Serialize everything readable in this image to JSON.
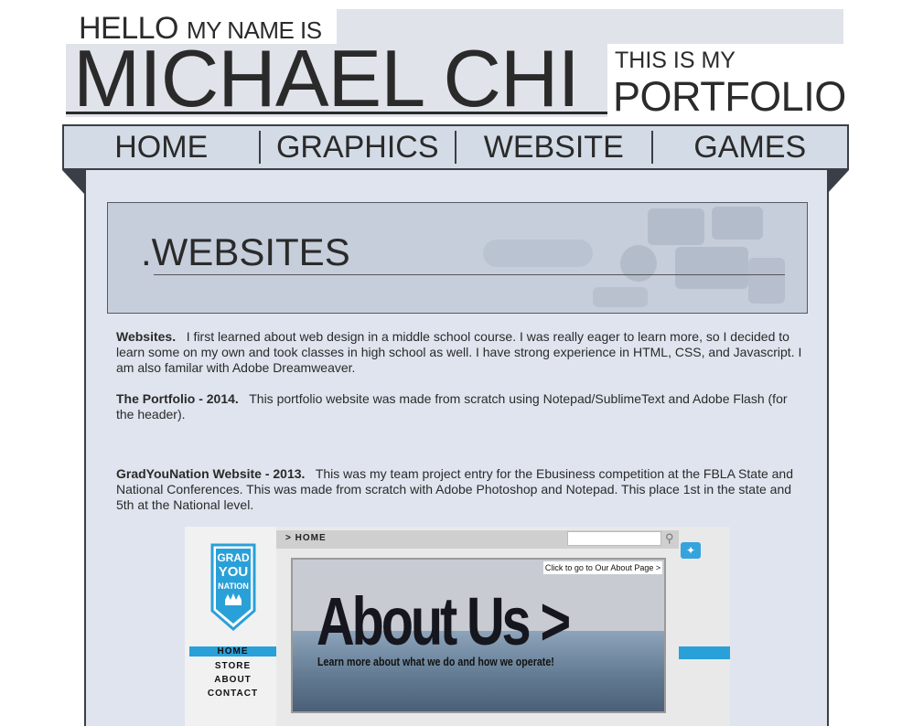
{
  "header": {
    "hello": "HELLO",
    "my_name_is": "MY NAME IS",
    "name": "MICHAEL CHI",
    "this_is_my": "THIS IS MY",
    "portfolio": "PORTFOLIO"
  },
  "nav": {
    "items": [
      {
        "label": "HOME"
      },
      {
        "label": "GRAPHICS"
      },
      {
        "label": "WEBSITE"
      },
      {
        "label": "GAMES"
      }
    ]
  },
  "banner": {
    "title": ".WEBSITES"
  },
  "paragraphs": [
    {
      "heading": "Websites.",
      "text": "I first learned about web design in a middle school course. I was really eager to learn more, so I decided to learn some on my own and took classes in high school as well. I have strong experience in HTML, CSS, and Javascript. I am also familar with Adobe Dreamweaver."
    },
    {
      "heading": "The Portfolio - 2014.",
      "text": "This portfolio website was made from scratch using Notepad/SublimeText and Adobe Flash (for the header)."
    },
    {
      "heading": "GradYouNation Website - 2013.",
      "text": "This was my team project entry for the Ebusiness competition at the FBLA State and National Conferences. This was made from scratch with Adobe Photoshop and Notepad. This place 1st in the state and 5th at the National level."
    }
  ],
  "screenshot": {
    "logo_lines": [
      "GRAD",
      "YOU",
      "NATION"
    ],
    "nav": [
      "HOME",
      "STORE",
      "ABOUT",
      "CONTACT"
    ],
    "breadcrumb": "> HOME",
    "click_text": "Click to go to Our About Page >",
    "hero_title": "About Us >",
    "hero_subtitle": "Learn more about what we do and how we operate!"
  },
  "colors": {
    "accent_blue": "#2aa0d8",
    "nav_bg": "#d3dbe6",
    "panel_bg": "#dfe4ee",
    "dark": "#2a2a2a"
  }
}
